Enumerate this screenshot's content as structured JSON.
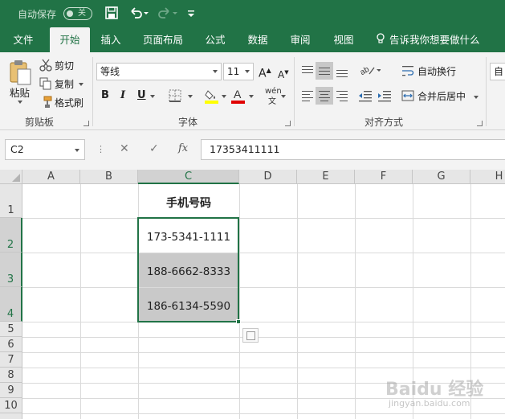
{
  "titlebar": {
    "autosave_label": "自动保存",
    "autosave_state": "关",
    "icons": [
      "save-icon",
      "undo-icon",
      "redo-icon",
      "customize-qat-icon"
    ]
  },
  "tabs": [
    {
      "label": "文件"
    },
    {
      "label": "开始"
    },
    {
      "label": "插入"
    },
    {
      "label": "页面布局"
    },
    {
      "label": "公式"
    },
    {
      "label": "数据"
    },
    {
      "label": "审阅"
    },
    {
      "label": "视图"
    }
  ],
  "tell_me": "告诉我你想要做什么",
  "clipboard": {
    "paste": "粘贴",
    "cut": "剪切",
    "copy": "复制",
    "format_painter": "格式刷",
    "group_label": "剪贴板"
  },
  "font": {
    "name": "等线",
    "size": "11",
    "bold": "B",
    "italic": "I",
    "underline": "U",
    "phonetic": "wén",
    "group_label": "字体",
    "grow_icon": "A",
    "shrink_icon": "A"
  },
  "alignment": {
    "wrap_text": "自动换行",
    "merge_center": "合并后居中",
    "group_label": "对齐方式"
  },
  "number_cut": "自",
  "formula_bar": {
    "name_box": "C2",
    "cancel": "✕",
    "enter": "✓",
    "fx": "fx",
    "value": "17353411111"
  },
  "grid": {
    "columns": [
      "A",
      "B",
      "C",
      "D",
      "E",
      "F",
      "G",
      "H"
    ],
    "rows": [
      "1",
      "2",
      "3",
      "4",
      "5",
      "6",
      "7",
      "8",
      "9",
      "10"
    ],
    "cells": {
      "C1": "手机号码",
      "C2": "173-5341-1111",
      "C3": "188-6662-8333",
      "C4": "186-6134-5590"
    }
  },
  "watermark": {
    "text": "Baidu 经验",
    "url": "jingyan.baidu.com"
  },
  "colors": {
    "excel_green": "#217346",
    "selected_gray": "#c9c9c9"
  }
}
